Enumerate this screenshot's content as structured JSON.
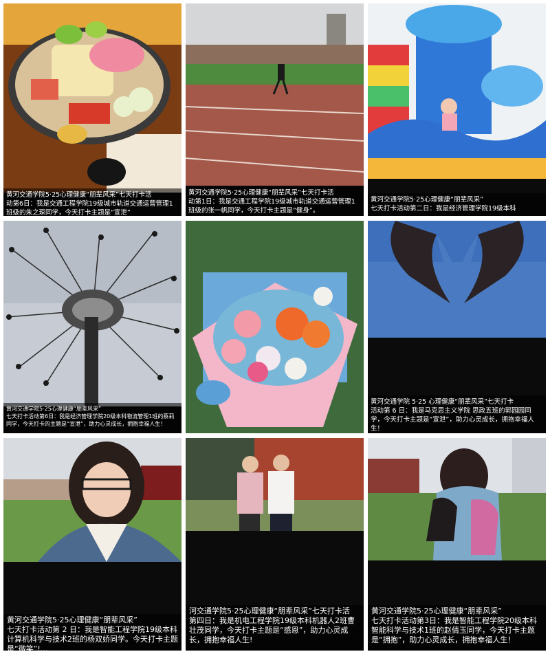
{
  "posts": [
    {
      "title": "黄河交通学院5·25心理健康“朋辈风采”七天打卡活",
      "body": "动第6日：我是交通工程学院19级城市轨道交通运营管理1班级的朱之琛同学，今天打卡主题是“宣泄”"
    },
    {
      "title": "黄河交通学院5·25心理健康“朋辈风采”七天打卡活",
      "body": "动第1日：我是交通工程学院19级城市轨道交通运营管理1班级的张一帆同学，今天打卡主题是“健身”。"
    },
    {
      "title": "黄河交通学院5·25心理健康“朋辈风采”",
      "body": "七天打卡活动第二日：我是经济管理学院19级本科"
    },
    {
      "title": "黄河交通学院5·25心理健康“朋辈风采”",
      "body": "七天打卡活动第6日：我是经济管理学院20级本科物流管理1班的蔡莉同学，今天打卡的主题是“宣泄”，助力心灵成长，拥抱幸福人生！"
    },
    {
      "title": "",
      "body": ""
    },
    {
      "title": "黄河交通学院 5·25 心理健康“朋辈风采”七天打卡",
      "body": "活动第 6 日：我是马克思主义学院 思政五班的郭园园同学，今天打卡主题是“宣泄”，助力心灵成长，拥抱幸福人生！"
    },
    {
      "title": "黄河交通学院5·25心理健康“朋辈风采”",
      "body": "七天打卡活动第 2 日：我是智能工程学院19级本科计算机科学与技术2班的杨双娇同学。今天打卡主题是“微笑”!..."
    },
    {
      "title": "河交通学院5·25心理健康“朋辈风采”七天打卡活",
      "body": "第四日：我是机电工程学院19级本科机器人2班曹壮茂同学，今天打卡主题是“感恩”，助力心灵成长，拥抱幸福人生!"
    },
    {
      "title": "黄河交通学院5·25心理健康“朋辈风采”",
      "body": "七天打卡活动第3日：我是智能工程学院20级本科智能科学与技术1班的赵倩玉同学，今天打卡主题是“拥抱”，助力心灵成长，拥抱幸福人生！"
    }
  ]
}
